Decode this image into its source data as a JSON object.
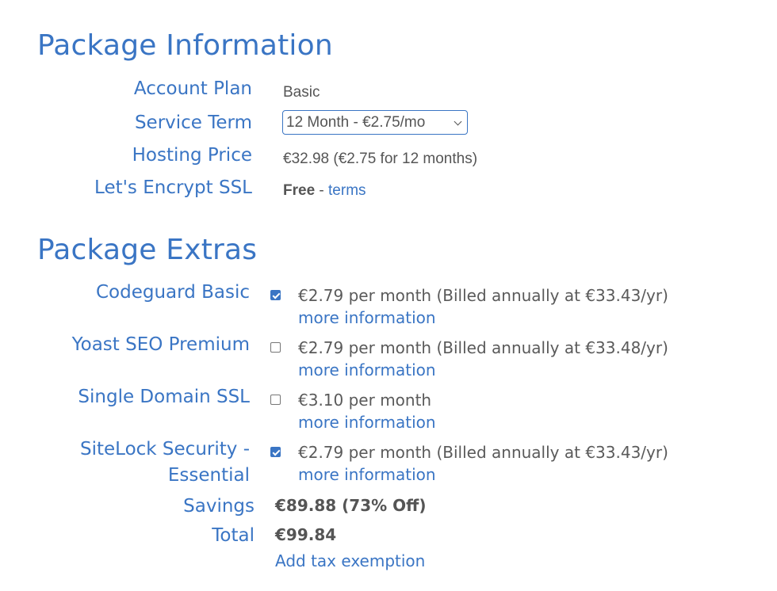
{
  "package_info": {
    "title": "Package Information",
    "rows": [
      {
        "label": "Account Plan",
        "value": "Basic"
      },
      {
        "label": "Service Term",
        "select_value": "12 Month - €2.75/mo"
      },
      {
        "label": "Hosting Price",
        "value": "€32.98 (€2.75 for 12 months)"
      },
      {
        "label": "Let's Encrypt SSL",
        "value_bold": "Free",
        "separator": " - ",
        "link": "terms"
      }
    ]
  },
  "package_extras": {
    "title": "Package Extras",
    "items": [
      {
        "label": "Codeguard Basic",
        "checked": true,
        "price": "€2.79 per month (Billed annually at €33.43/yr)",
        "link": "more information"
      },
      {
        "label": "Yoast SEO Premium",
        "checked": false,
        "price": "€2.79 per month (Billed annually at €33.48/yr)",
        "link": "more information"
      },
      {
        "label": "Single Domain SSL",
        "checked": false,
        "price": "€3.10 per month",
        "link": "more information"
      },
      {
        "label_line1": "SiteLock Security -",
        "label_line2": "Essential",
        "checked": true,
        "price": "€2.79 per month (Billed annually at €33.43/yr)",
        "link": "more information"
      }
    ]
  },
  "summary": {
    "savings_label": "Savings",
    "savings_value": "€89.88 (73% Off)",
    "total_label": "Total",
    "total_value": "€99.84",
    "tax_link": "Add tax exemption"
  },
  "colors": {
    "accent": "#3a75c4",
    "text": "#555555"
  }
}
